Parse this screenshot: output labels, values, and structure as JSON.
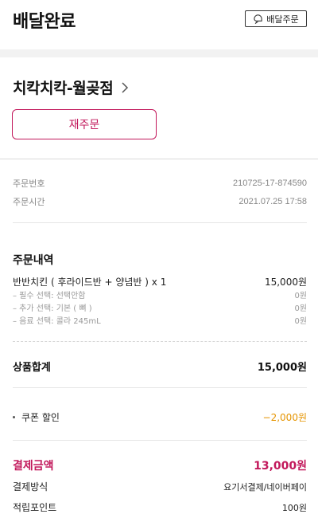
{
  "header": {
    "title": "배달완료",
    "delivery_button": "배달주문"
  },
  "store": {
    "name": "치칵치칵-월곶점",
    "reorder_button": "재주문"
  },
  "order_meta": {
    "number_label": "주문번호",
    "number_value": "210725-17-874590",
    "time_label": "주문시간",
    "time_value": "2021.07.25 17:58"
  },
  "order_details": {
    "title": "주문내역",
    "item": {
      "name": "반반치킨 ( 후라이드반 + 양념반 )  x 1",
      "price": "15,000원"
    },
    "options": [
      {
        "label": "– 필수 선택: 선택안함",
        "price": "0원"
      },
      {
        "label": "– 추가 선택: 기본 ( 뼈 )",
        "price": "0원"
      },
      {
        "label": "– 음료 선택: 콜라 245mL",
        "price": "0원"
      }
    ]
  },
  "subtotal": {
    "label": "상품합계",
    "value": "15,000원"
  },
  "coupon": {
    "label": "쿠폰 할인",
    "value": "−2,000원"
  },
  "payment": {
    "total_label": "결제금액",
    "total_value": "13,000원",
    "method_label": "결제방식",
    "method_value": "요기서결제/네이버페이",
    "points_label": "적립포인트",
    "points_value": "100원"
  },
  "colors": {
    "accent": "#c2185b",
    "coupon": "#e59400"
  }
}
